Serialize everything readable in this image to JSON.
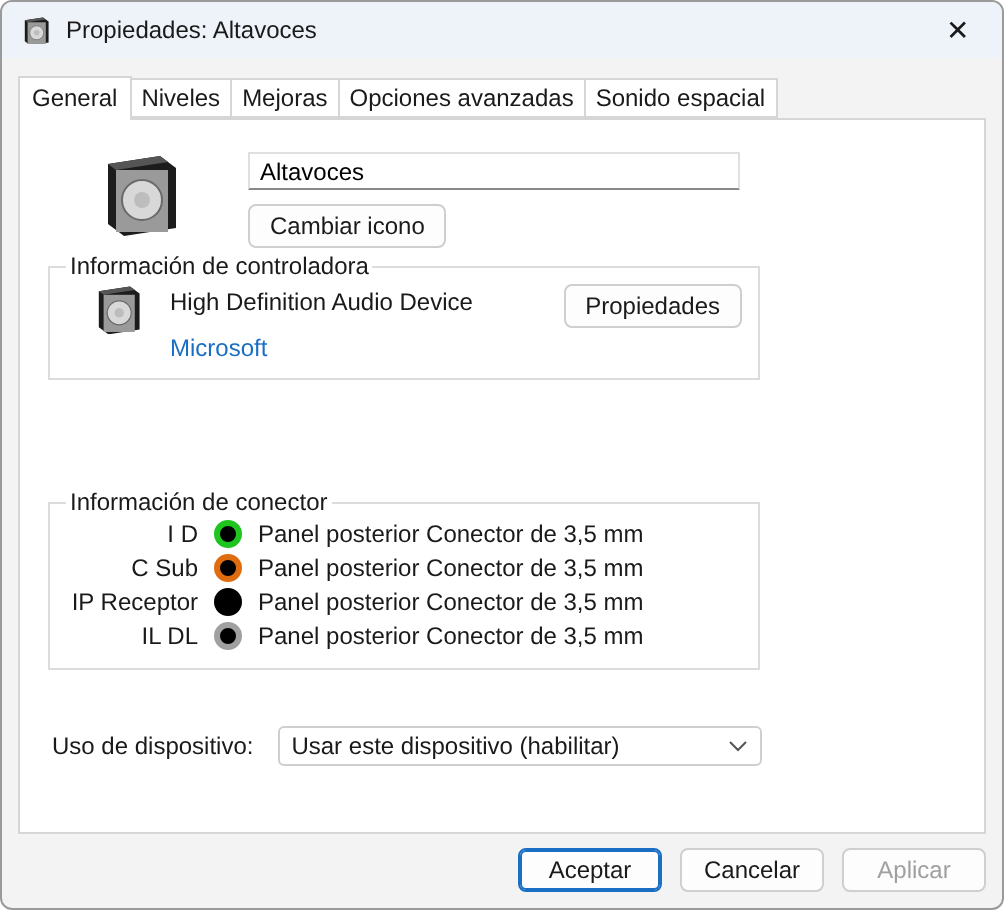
{
  "window": {
    "title": "Propiedades: Altavoces",
    "close": "✕"
  },
  "tabs": [
    {
      "label": "General",
      "selected": true
    },
    {
      "label": "Niveles",
      "selected": false
    },
    {
      "label": "Mejoras",
      "selected": false
    },
    {
      "label": "Opciones avanzadas",
      "selected": false
    },
    {
      "label": "Sonido espacial",
      "selected": false
    }
  ],
  "general": {
    "name": "Altavoces",
    "change_icon_button": "Cambiar icono"
  },
  "controller": {
    "title": "Información de controladora",
    "device": "High Definition Audio Device",
    "vendor": "Microsoft",
    "button": "Propiedades"
  },
  "connector": {
    "title": "Información de conector",
    "rows": [
      {
        "label": "I D",
        "color": "#1fc41f",
        "description": "Panel posterior Conector de 3,5 mm"
      },
      {
        "label": "C Sub",
        "color": "#e06c10",
        "description": "Panel posterior Conector de 3,5 mm"
      },
      {
        "label": "IP Receptor",
        "color": "#000000",
        "description": "Panel posterior Conector de 3,5 mm"
      },
      {
        "label": "IL DL",
        "color": "#a0a0a0",
        "description": "Panel posterior Conector de 3,5 mm"
      }
    ]
  },
  "usage": {
    "label": "Uso de dispositivo:",
    "value": "Usar este dispositivo (habilitar)"
  },
  "buttons": [
    {
      "label": "Aceptar",
      "kind": "default",
      "disabled": false
    },
    {
      "label": "Cancelar",
      "kind": "normal",
      "disabled": false
    },
    {
      "label": "Aplicar",
      "kind": "normal",
      "disabled": true
    }
  ]
}
